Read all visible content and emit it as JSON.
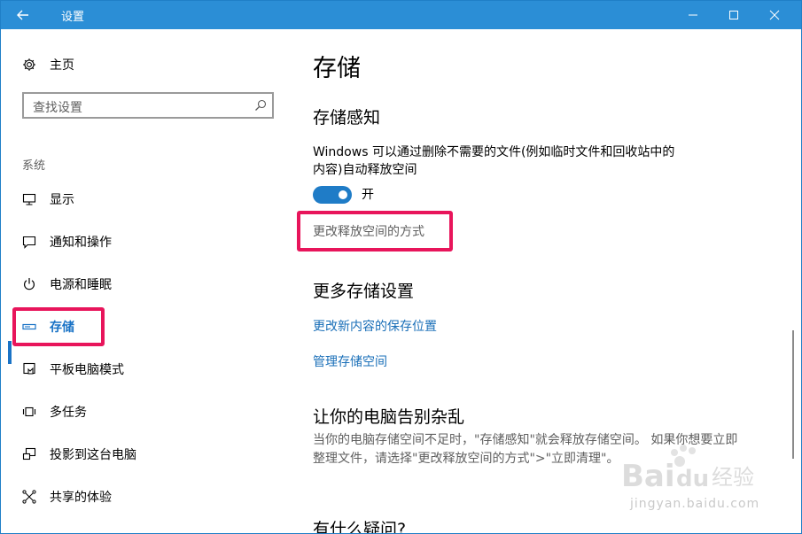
{
  "window": {
    "title": "设置"
  },
  "sidebar": {
    "home_label": "主页",
    "search_placeholder": "查找设置",
    "section_label": "系统",
    "items": [
      {
        "label": "显示",
        "icon": "monitor-icon"
      },
      {
        "label": "通知和操作",
        "icon": "notification-icon"
      },
      {
        "label": "电源和睡眠",
        "icon": "power-icon"
      },
      {
        "label": "存储",
        "icon": "storage-icon",
        "selected": true
      },
      {
        "label": "平板电脑模式",
        "icon": "tablet-mode-icon"
      },
      {
        "label": "多任务",
        "icon": "multitask-icon"
      },
      {
        "label": "投影到这台电脑",
        "icon": "project-icon"
      },
      {
        "label": "共享的体验",
        "icon": "share-icon"
      }
    ]
  },
  "content": {
    "page_title": "存储",
    "storage_sense": {
      "heading": "存储感知",
      "description_line1": "Windows 可以通过删除不需要的文件(例如临时文件和回收站中的",
      "description_line2": "内容)自动释放空间",
      "toggle_state": "开",
      "change_link": "更改释放空间的方式"
    },
    "more_storage": {
      "heading": "更多存储设置",
      "link1": "更改新内容的保存位置",
      "link2": "管理存储空间"
    },
    "declutter": {
      "heading": "让你的电脑告别杂乱",
      "text_line1": "当你的电脑存储空间不足时，\"存储感知\"就会释放存储空间。 如果你想要立即",
      "text_line2": "整理文件，请选择\"更改释放空间的方式\">\"立即清理\"。"
    },
    "questions_heading": "有什么疑问?"
  },
  "watermark": {
    "brand": "Baidu经验",
    "site": "jingyan.baidu.com"
  },
  "colors": {
    "titlebar": "#2b8ed6",
    "accent": "#1a73c6",
    "highlight_box": "#e8155b",
    "link": "#1a6fb8"
  }
}
